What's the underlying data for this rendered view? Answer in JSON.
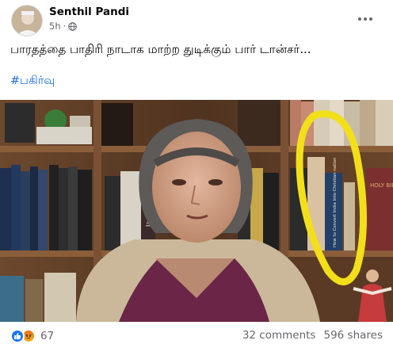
{
  "post": {
    "author": "Senthil Pandi",
    "time": "5h",
    "separator": "·",
    "text": "பாரதத்தை பாதிரி நாடாக மாற்ற துடிக்கும் பார் டான்சர்...",
    "hashtag": "#பகிர்வு"
  },
  "media": {
    "book_title_1": "How to Convert India into Christian nation",
    "book_title_2": "HOLY BIBLE",
    "book_title_3": "James Collins",
    "highlight_color": "#f2df1a"
  },
  "footer": {
    "reaction_count": "67",
    "comments": "32 comments",
    "shares": "596 shares",
    "reaction_icons": [
      "like-icon",
      "angry-icon"
    ]
  },
  "colors": {
    "hashtag": "#216fdb",
    "muted": "#65676b",
    "like": "#1877f2"
  }
}
